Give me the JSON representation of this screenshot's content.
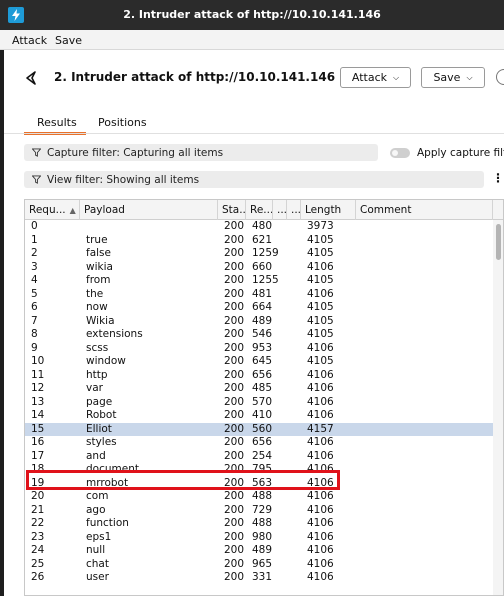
{
  "window": {
    "title": "2. Intruder attack of http://10.10.141.146"
  },
  "menu": {
    "attack": "Attack",
    "save": "Save"
  },
  "header": {
    "title": "2. Intruder attack of http://10.10.141.146",
    "attack_button": "Attack",
    "save_button": "Save"
  },
  "tabs": {
    "results": "Results",
    "positions": "Positions",
    "active": "Results"
  },
  "filters": {
    "capture": "Capture filter: Capturing all items",
    "view": "View filter: Showing all items",
    "apply_capture": "Apply capture filter",
    "apply_capture_enabled": false
  },
  "table": {
    "columns": [
      "Requ...",
      "Payload",
      "Sta...",
      "Re...",
      "...",
      "...",
      "Length",
      "Comment"
    ],
    "sort_column": "Requ...",
    "sort_direction": "ascending",
    "selected_request": "15",
    "rows": [
      [
        "0",
        "",
        "200",
        "480",
        "3973"
      ],
      [
        "1",
        "true",
        "200",
        "621",
        "4105"
      ],
      [
        "2",
        "false",
        "200",
        "1259",
        "4105"
      ],
      [
        "3",
        "wikia",
        "200",
        "660",
        "4106"
      ],
      [
        "4",
        "from",
        "200",
        "1255",
        "4105"
      ],
      [
        "5",
        "the",
        "200",
        "481",
        "4106"
      ],
      [
        "6",
        "now",
        "200",
        "664",
        "4105"
      ],
      [
        "7",
        "Wikia",
        "200",
        "489",
        "4105"
      ],
      [
        "8",
        "extensions",
        "200",
        "546",
        "4105"
      ],
      [
        "9",
        "scss",
        "200",
        "953",
        "4106"
      ],
      [
        "10",
        "window",
        "200",
        "645",
        "4105"
      ],
      [
        "11",
        "http",
        "200",
        "656",
        "4106"
      ],
      [
        "12",
        "var",
        "200",
        "485",
        "4106"
      ],
      [
        "13",
        "page",
        "200",
        "570",
        "4106"
      ],
      [
        "14",
        "Robot",
        "200",
        "410",
        "4106"
      ],
      [
        "15",
        "Elliot",
        "200",
        "560",
        "4157"
      ],
      [
        "16",
        "styles",
        "200",
        "656",
        "4106"
      ],
      [
        "17",
        "and",
        "200",
        "254",
        "4106"
      ],
      [
        "18",
        "document",
        "200",
        "795",
        "4106"
      ],
      [
        "19",
        "mrrobot",
        "200",
        "563",
        "4106"
      ],
      [
        "20",
        "com",
        "200",
        "488",
        "4106"
      ],
      [
        "21",
        "ago",
        "200",
        "729",
        "4106"
      ],
      [
        "22",
        "function",
        "200",
        "488",
        "4106"
      ],
      [
        "23",
        "eps1",
        "200",
        "980",
        "4106"
      ],
      [
        "24",
        "null",
        "200",
        "489",
        "4106"
      ],
      [
        "25",
        "chat",
        "200",
        "965",
        "4106"
      ],
      [
        "26",
        "user",
        "200",
        "331",
        "4106"
      ]
    ]
  },
  "colors": {
    "accent_tab": "#e8712b",
    "highlight_box": "#e0121a",
    "selected_row": "#c9d7ea",
    "app_icon": "#1e9bd7"
  }
}
